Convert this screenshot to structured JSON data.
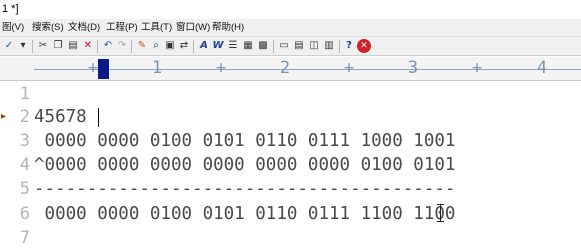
{
  "window": {
    "title": "1 *]"
  },
  "menu": {
    "items": [
      "图(V)",
      "搜索(S)",
      "文档(D)",
      "工程(P)",
      "工具(T)",
      "窗口(W)",
      "帮助(H)"
    ]
  },
  "toolbar": {
    "icons": [
      "spellcheck-icon",
      "cut-icon",
      "copy-icon",
      "paste-icon",
      "delete-icon",
      "undo-icon",
      "redo-icon",
      "format-icon",
      "find-icon",
      "find-files-icon",
      "replace-icon",
      "font-icon",
      "wordwrap-icon",
      "list-icon",
      "columns-icon",
      "window-icon",
      "window2-icon",
      "window3-icon",
      "window4-icon",
      "help-icon",
      "stop-icon"
    ]
  },
  "ruler": {
    "marks": [
      "1",
      "2",
      "3",
      "4"
    ],
    "dashes": [
      "----+",
      "----",
      "----+----",
      "----+----",
      "----+----",
      "-"
    ]
  },
  "editor": {
    "lines": [
      {
        "number": "1",
        "text": ""
      },
      {
        "number": "2",
        "text": "45678"
      },
      {
        "number": "3",
        "text": " 0000 0000 0100 0101 0110 0111 1000 1001"
      },
      {
        "number": "4",
        "text": "^0000 0000 0000 0000 0000 0000 0100 0101"
      },
      {
        "number": "5",
        "text": "----------------------------------------"
      },
      {
        "number": "6",
        "text": " 0000 0000 0100 0101 0110 0111 1100 1100"
      },
      {
        "number": "7",
        "text": ""
      }
    ]
  },
  "colors": {
    "ruler_text": "#7f93b0",
    "line_number": "#b4b4b4",
    "editor_text": "#4a4a4a",
    "ruler_cursor": "#0a1a8a"
  }
}
